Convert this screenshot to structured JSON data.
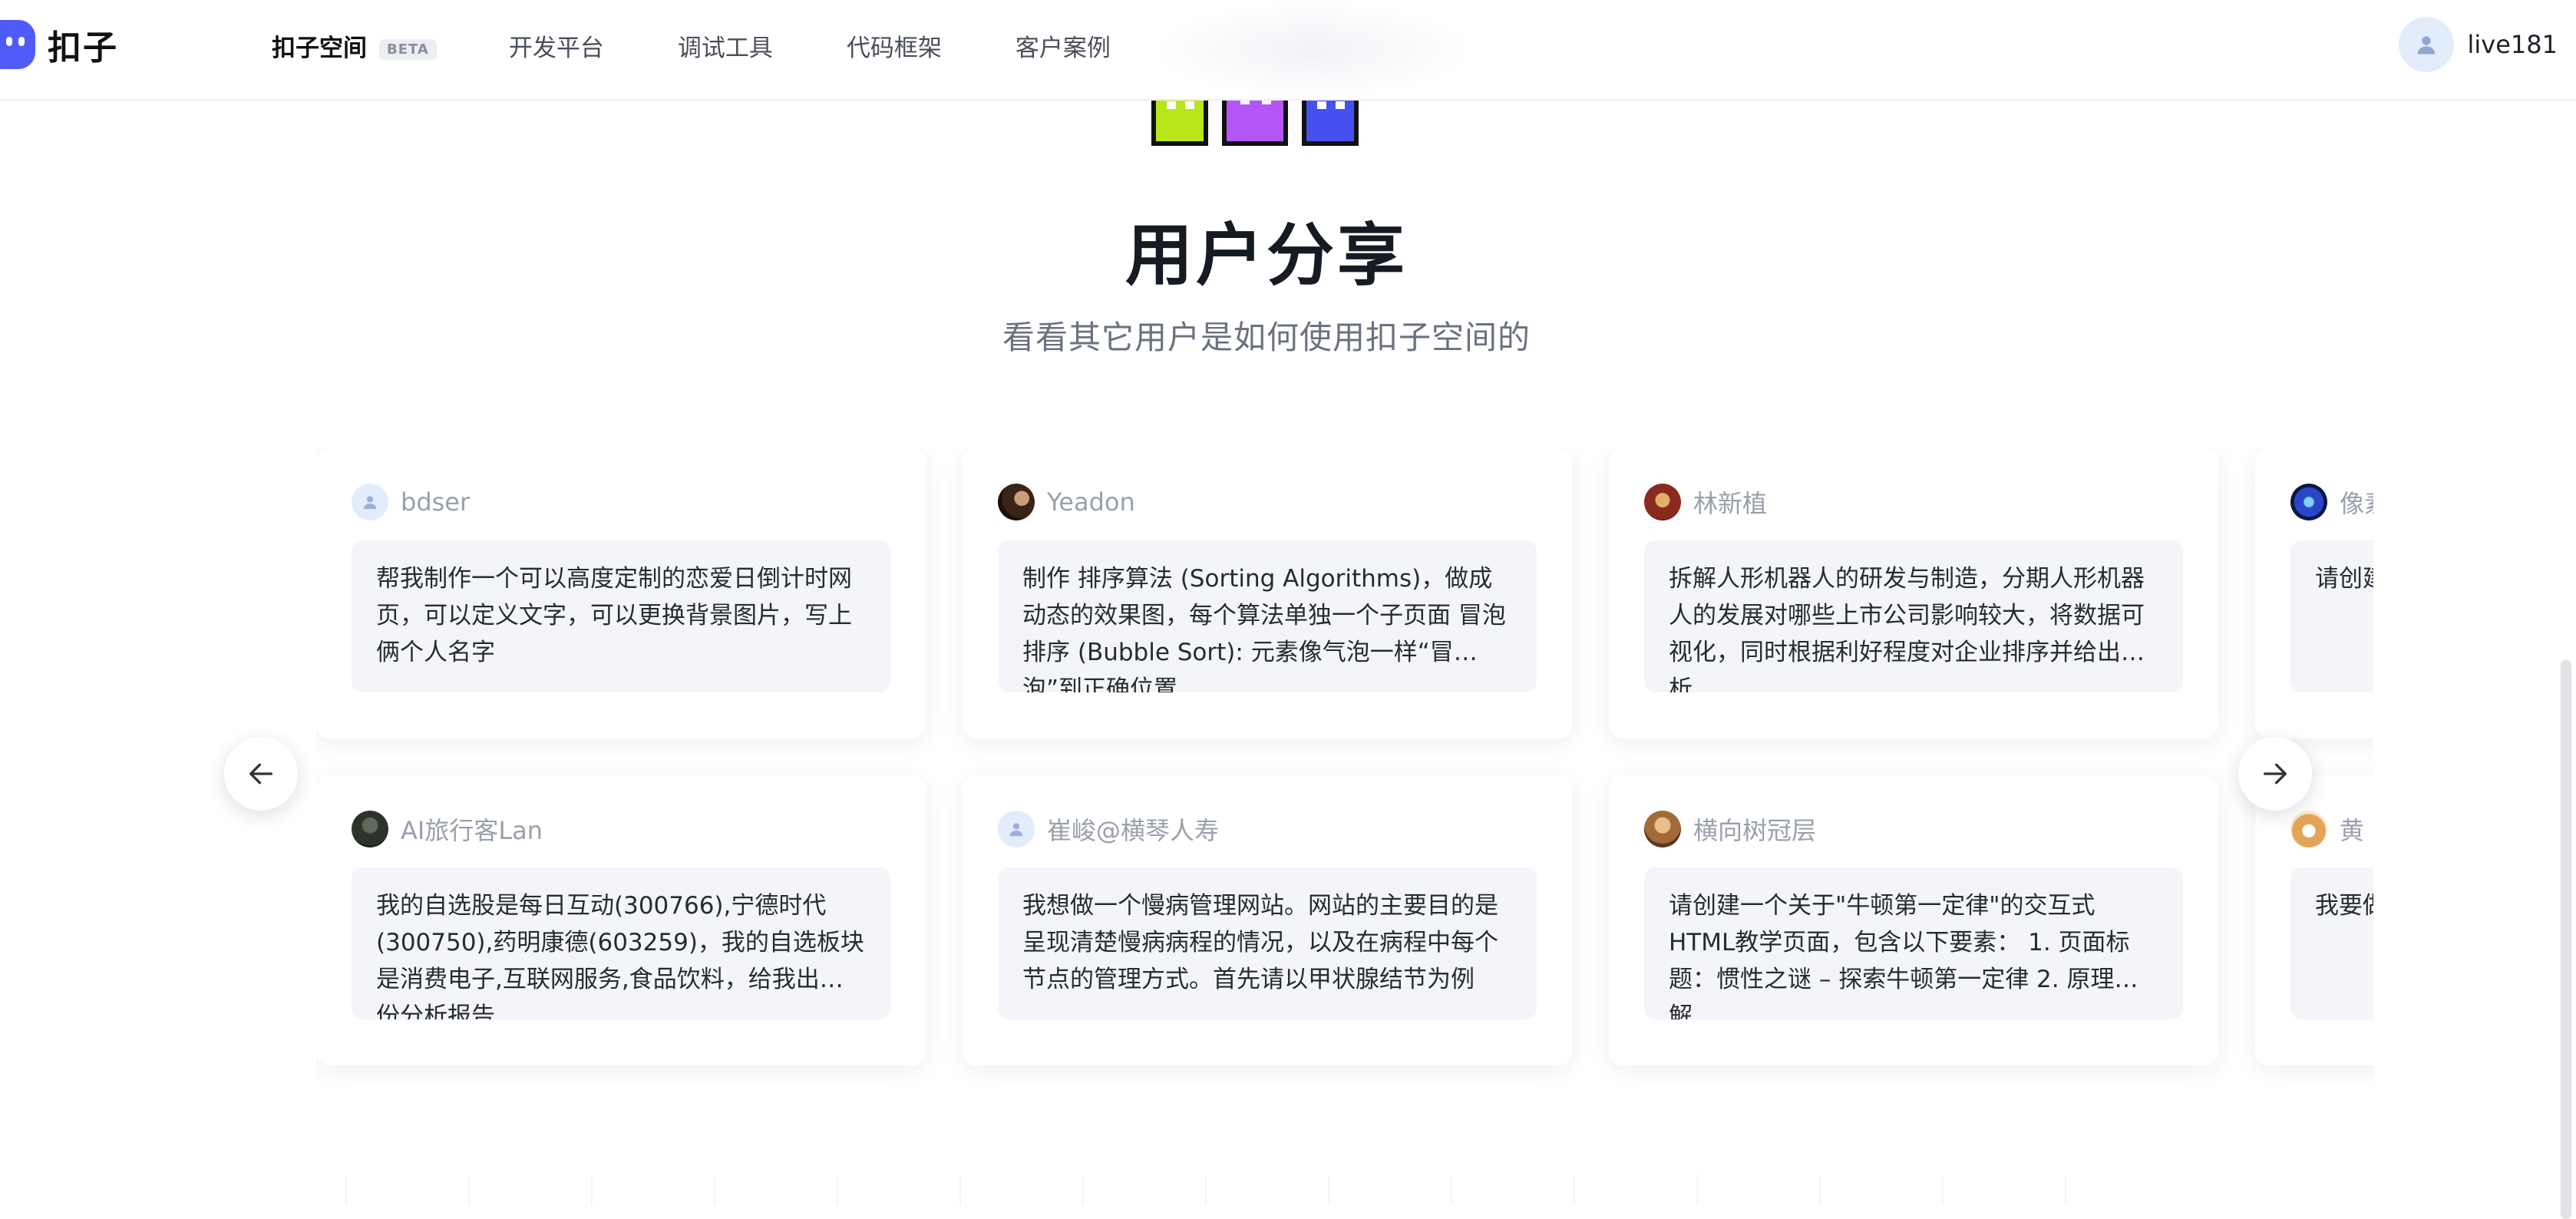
{
  "header": {
    "logo_text": "扣子",
    "nav": [
      {
        "label": "扣子空间",
        "badge": "BETA"
      },
      {
        "label": "开发平台"
      },
      {
        "label": "调试工具"
      },
      {
        "label": "代码框架"
      },
      {
        "label": "客户案例"
      }
    ],
    "user_name": "live181"
  },
  "hero": {
    "title": "用户分享",
    "subtitle": "看看其它用户是如何使用扣子空间的"
  },
  "cards": [
    {
      "name": "bdser",
      "avatar": "default-user-icon",
      "prompt": "帮我制作一个可以高度定制的恋爱日倒计时网页，可以定义文字，可以更换背景图片，写上俩个人名字"
    },
    {
      "name": "Yeadon",
      "avatar": "photo",
      "prompt": "制作 排序算法 (Sorting Algorithms)，做成动态的效果图，每个算法单独一个子页面 冒泡排序 (Bubble Sort): 元素像气泡一样“冒泡”到正确位置"
    },
    {
      "name": "林新植",
      "avatar": "photo",
      "prompt": "拆解人形机器人的研发与制造，分期人形机器人的发展对哪些上市公司影响较大，将数据可视化，同时根据利好程度对企业排序并给出分析"
    },
    {
      "name": "像素",
      "avatar": "photo",
      "prompt": "请创建一个具体要求池污染"
    },
    {
      "name": "AI旅行客Lan",
      "avatar": "photo",
      "prompt": "我的自选股是每日互动(300766),宁德时代(300750),药明康德(603259)，我的自选板块是消费电子,互联网服务,食品饮料，给我出一份分析报告"
    },
    {
      "name": "崔峻@横琴人寿",
      "avatar": "default-user-icon",
      "prompt": "我想做一个慢病管理网站。网站的主要目的是呈现清楚慢病病程的情况，以及在病程中每个节点的管理方式。首先请以甲状腺结节为例"
    },
    {
      "name": "横向树冠层",
      "avatar": "photo",
      "prompt": "请创建一个关于\"牛顿第一定律\"的交互式HTML教学页面，包含以下要素： 1. 页面标题：惯性之谜 – 探索牛顿第一定律 2. 原理讲解"
    },
    {
      "name": "黄",
      "avatar": "photo",
      "prompt": "我要做一个视频，我后采用"
    }
  ],
  "colors": {
    "brand": "#4e5bf7",
    "ghost_green": "#b8e619",
    "ghost_purple": "#b455f5",
    "ghost_blue": "#4650f0"
  }
}
